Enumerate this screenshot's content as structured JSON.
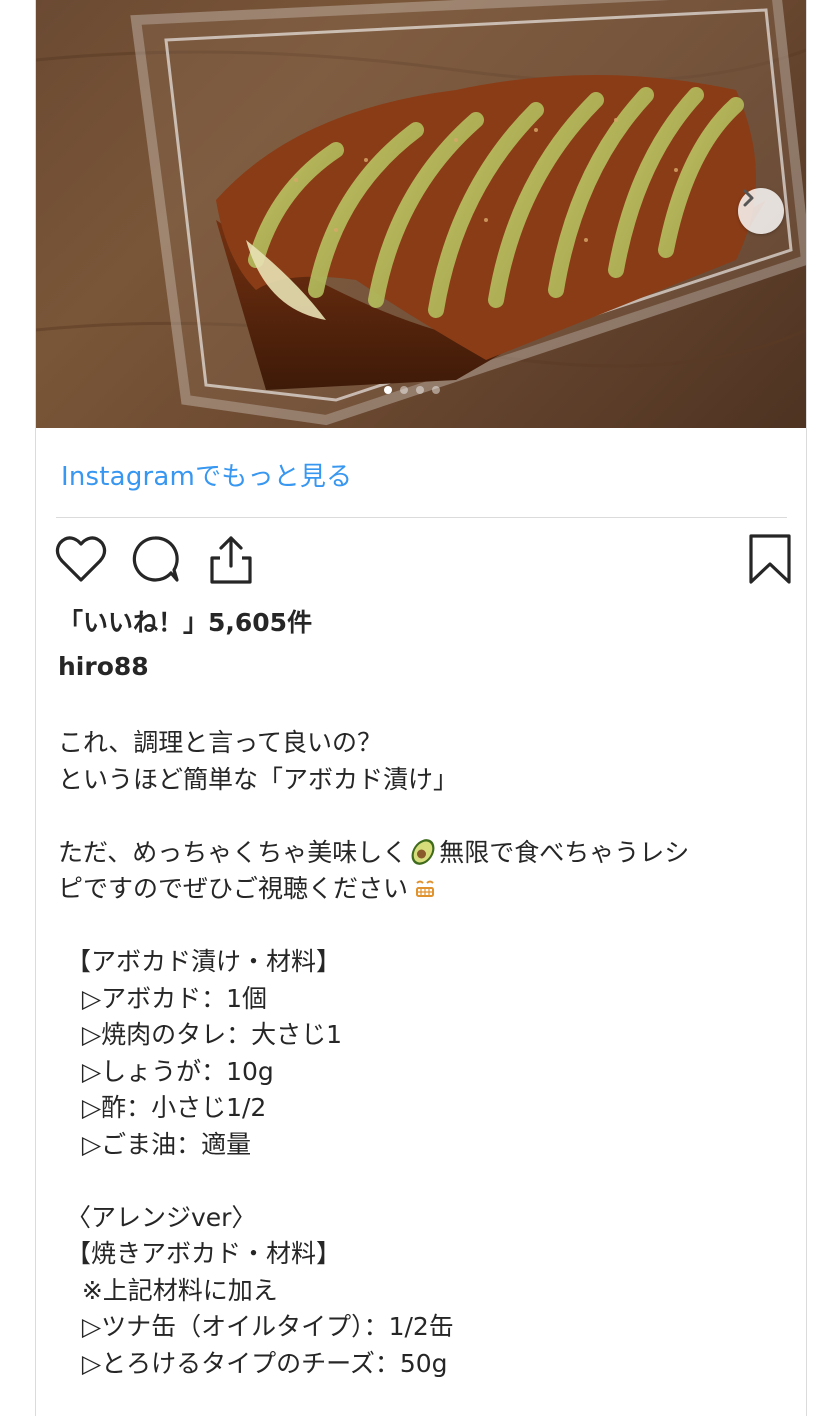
{
  "post": {
    "image_description_icon": "avocado-photo",
    "carousel": {
      "current": 1,
      "total": 4
    }
  },
  "more_link": "Instagramでもっと見る",
  "actions": {
    "like_icon": "heart-icon",
    "comment_icon": "comment-icon",
    "share_icon": "share-icon",
    "save_icon": "bookmark-icon"
  },
  "likes_text": "「いいね！」5,605件",
  "username": "hiro88",
  "caption": {
    "l1": "これ、調理と言って良いの？",
    "l2": "というほど簡単な「アボカド漬け」",
    "l3a": "ただ、めっちゃくちゃ美味しく",
    "l3b": "無限で食べちゃうレシ",
    "l4a": "ピですのでぜひご視聴ください",
    "l5": " 【アボカド漬け・材料】",
    "l6": "   ▷アボカド：1個",
    "l7": "   ▷焼肉のタレ：大さじ1",
    "l8": "   ▷しょうが：10g",
    "l9": "   ▷酢：小さじ1/2",
    "l10": "   ▷ごま油：適量",
    "l11": " 〈アレンジver〉",
    "l12": " 【焼きアボカド・材料】",
    "l13": "   ※上記材料に加え",
    "l14": "   ▷ツナ缶（オイルタイプ）：1/2缶",
    "l15": "   ▷とろけるタイプのチーズ：50g"
  },
  "emoji": {
    "avocado": "avocado-emoji",
    "smile": "grin-emoji"
  }
}
